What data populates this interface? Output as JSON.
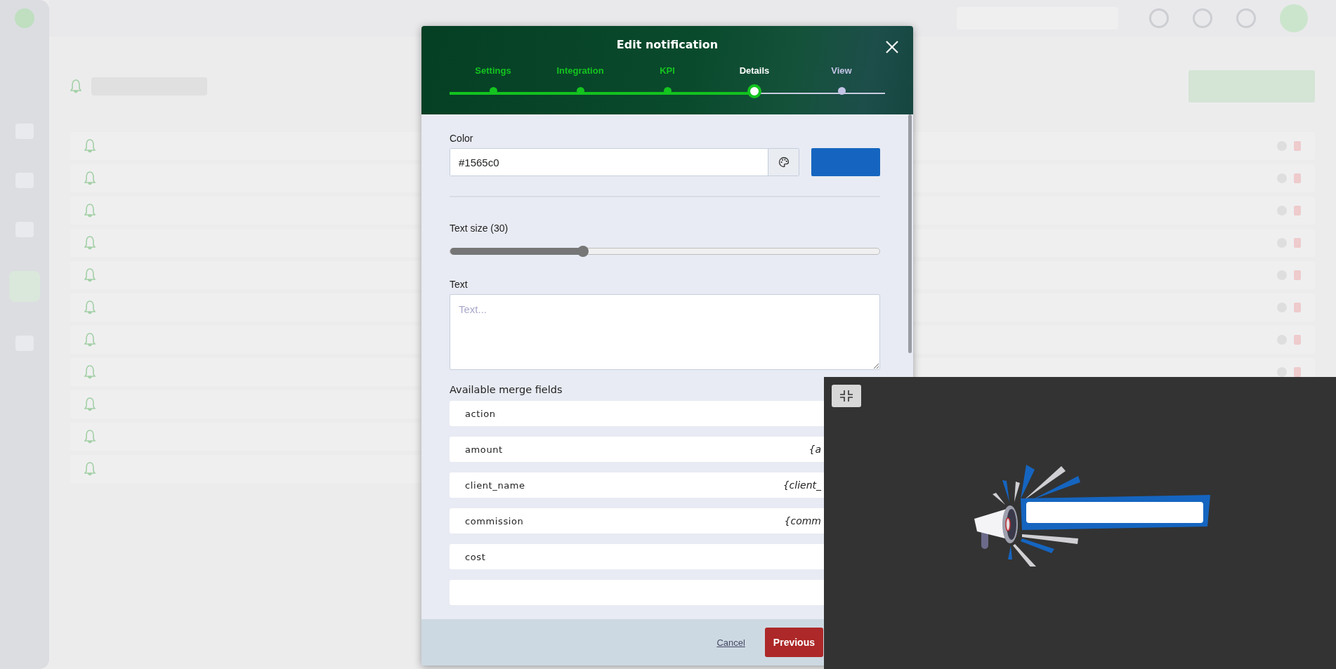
{
  "modal": {
    "title": "Edit notification",
    "steps": [
      {
        "label": "Settings",
        "completed": true,
        "selected": false
      },
      {
        "label": "Integration",
        "completed": true,
        "selected": false
      },
      {
        "label": "KPI",
        "completed": true,
        "selected": false
      },
      {
        "label": "Details",
        "completed": false,
        "selected": true
      },
      {
        "label": "View",
        "completed": false,
        "selected": false
      }
    ],
    "color": {
      "label": "Color",
      "value": "#1565c0"
    },
    "text_size": {
      "label": "Text size (30)",
      "level": 0.31
    },
    "text": {
      "label": "Text",
      "placeholder": "Text..."
    },
    "merge_fields": {
      "title": "Available merge fields",
      "items": [
        {
          "name": "action"
        },
        {
          "name": "amount",
          "token": "{a"
        },
        {
          "name": "client_name",
          "token": "{client_"
        },
        {
          "name": "commission",
          "token": "{comm"
        },
        {
          "name": "cost"
        }
      ]
    },
    "footer": {
      "cancel": "Cancel",
      "previous": "Previous"
    }
  }
}
